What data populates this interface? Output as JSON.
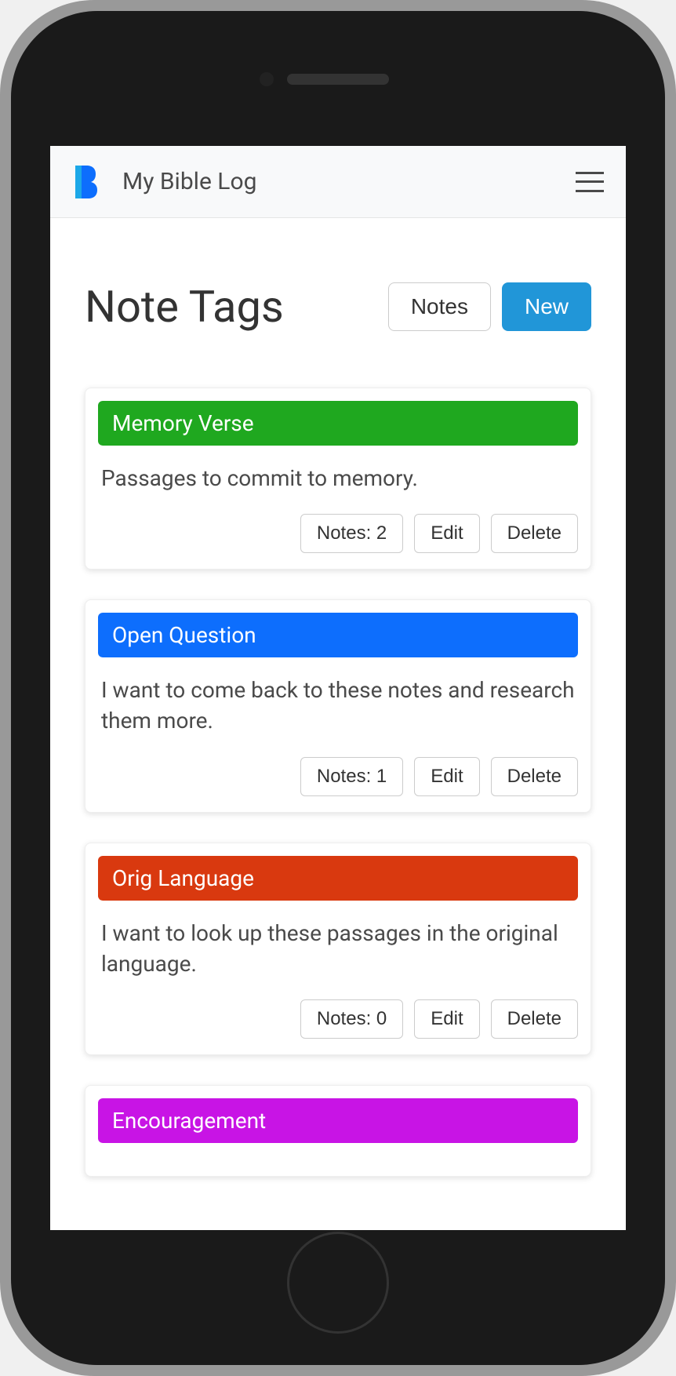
{
  "nav": {
    "title": "My Bible Log"
  },
  "page": {
    "title": "Note Tags",
    "notes_btn": "Notes",
    "new_btn": "New"
  },
  "actions": {
    "edit": "Edit",
    "delete": "Delete"
  },
  "tags": [
    {
      "name": "Memory Verse",
      "color": "#1fa81f",
      "description": "Passages to commit to memory.",
      "notes_count": 2,
      "notes_label": "Notes: 2"
    },
    {
      "name": "Open Question",
      "color": "#0d6efd",
      "description": "I want to come back to these notes and research them more.",
      "notes_count": 1,
      "notes_label": "Notes: 1"
    },
    {
      "name": "Orig Language",
      "color": "#d9390f",
      "description": "I want to look up these passages in the original language.",
      "notes_count": 0,
      "notes_label": "Notes: 0"
    },
    {
      "name": "Encouragement",
      "color": "#c814e5",
      "description": "",
      "notes_count": null,
      "notes_label": ""
    }
  ]
}
